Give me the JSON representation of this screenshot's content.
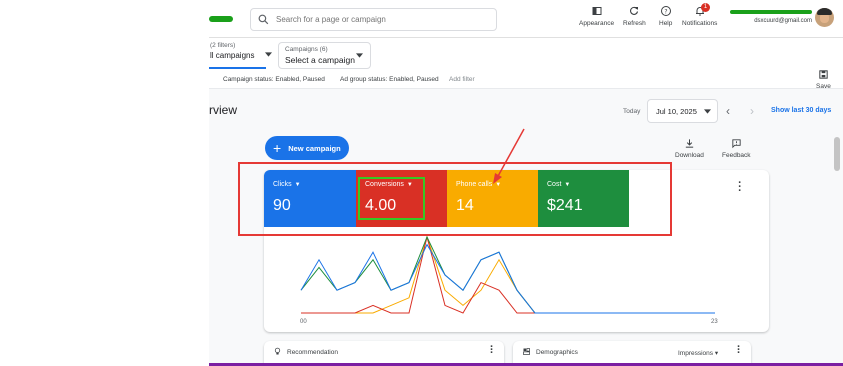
{
  "search": {
    "placeholder": "Search for a page or campaign"
  },
  "toolbar": {
    "appearance": "Appearance",
    "refresh": "Refresh",
    "help": "Help",
    "notifications": "Notifications",
    "notification_count": "1"
  },
  "account": {
    "name_scribbled": "REDACTED",
    "email": "dsxcuurd@gmail.com"
  },
  "filters": {
    "campaigns_filter_count": "(2 filters)",
    "campaigns_filter_value": "ll campaigns",
    "campaigns_label": "Campaigns (6)",
    "campaigns_value": "Select a campaign",
    "chip_campaign_status": "Campaign status: Enabled, Paused",
    "chip_adgroup_status": "Ad group status: Enabled, Paused",
    "add_filter": "Add filter",
    "save": "Save"
  },
  "overview": {
    "title": "rview",
    "today_label": "Today",
    "date": "Jul 10, 2025",
    "show_last": "Show last 30 days",
    "new_campaign": "New campaign",
    "download": "Download",
    "feedback": "Feedback"
  },
  "metrics": [
    {
      "label": "Clicks",
      "value": "90",
      "color": "#1a73e8"
    },
    {
      "label": "Conversions",
      "value": "4.00",
      "color": "#d93025"
    },
    {
      "label": "Phone calls",
      "value": "14",
      "color": "#f9ab00"
    },
    {
      "label": "Cost",
      "value": "$241",
      "color": "#1e8e3e"
    }
  ],
  "chart_data": {
    "type": "line",
    "x_start_label": "00",
    "x_end_label": "23",
    "x": [
      0,
      1,
      2,
      3,
      4,
      5,
      6,
      7,
      8,
      9,
      10,
      11,
      12,
      13,
      14,
      15,
      16,
      17,
      18,
      19,
      20,
      21,
      22,
      23
    ],
    "series": [
      {
        "color": "#1a73e8",
        "values": [
          3,
          7,
          3,
          4,
          8,
          3,
          4,
          9,
          5,
          3,
          7,
          8,
          3,
          0,
          0,
          0,
          0,
          0,
          0,
          0,
          0,
          0,
          0,
          0
        ]
      },
      {
        "color": "#1e8e3e",
        "values": [
          3,
          6,
          3,
          4,
          7,
          3,
          4,
          10,
          5,
          3,
          7,
          8,
          3,
          0,
          0,
          0,
          0,
          0,
          0,
          0,
          0,
          0,
          0,
          0
        ]
      },
      {
        "color": "#d93025",
        "values": [
          0,
          0,
          0,
          0,
          1,
          0,
          0,
          10,
          1,
          0,
          4,
          3,
          0,
          0,
          0,
          0,
          0,
          0,
          0,
          0,
          0,
          0,
          0,
          0
        ]
      },
      {
        "color": "#f9ab00",
        "values": [
          0,
          0,
          0,
          0,
          0,
          1,
          2,
          10,
          3,
          1,
          3,
          7,
          3,
          0,
          0,
          0,
          0,
          0,
          0,
          0,
          0,
          0,
          0,
          0
        ]
      }
    ]
  },
  "bottom": {
    "recommendation": "Recommendation",
    "demographics": "Demographics",
    "impressions": "Impressions"
  }
}
